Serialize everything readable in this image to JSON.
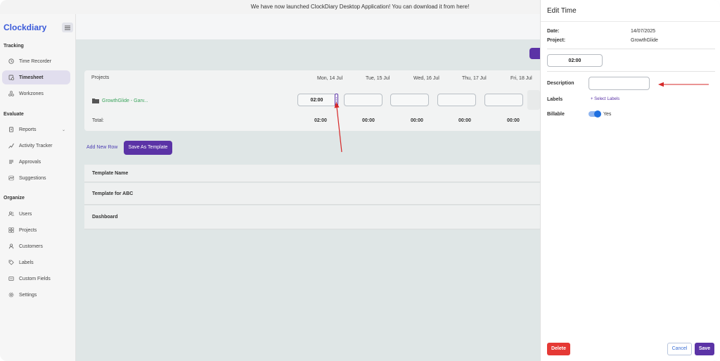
{
  "banner": {
    "text": "We have now launched ClockDiary Desktop Application! You can download it from here!"
  },
  "brand": {
    "logo": "Clockdiary",
    "color": "#3a5ad9",
    "accent": "#5b33a6"
  },
  "sidebar": {
    "sections": [
      {
        "title": "Tracking",
        "items": [
          {
            "label": "Time Recorder",
            "icon": "clock-icon"
          },
          {
            "label": "Timesheet",
            "icon": "timesheet-icon",
            "active": true
          },
          {
            "label": "Workzones",
            "icon": "workzones-icon"
          }
        ]
      },
      {
        "title": "Evaluate",
        "items": [
          {
            "label": "Reports",
            "icon": "reports-icon",
            "expandable": true
          },
          {
            "label": "Activity Tracker",
            "icon": "activity-icon"
          },
          {
            "label": "Approvals",
            "icon": "approvals-icon"
          },
          {
            "label": "Suggestions",
            "icon": "suggestions-icon"
          }
        ]
      },
      {
        "title": "Organize",
        "items": [
          {
            "label": "Users",
            "icon": "users-icon"
          },
          {
            "label": "Projects",
            "icon": "projects-icon"
          },
          {
            "label": "Customers",
            "icon": "customers-icon"
          },
          {
            "label": "Labels",
            "icon": "labels-icon"
          },
          {
            "label": "Custom Fields",
            "icon": "custom-fields-icon"
          },
          {
            "label": "Settings",
            "icon": "settings-icon"
          }
        ]
      }
    ]
  },
  "timesheet": {
    "projects_header": "Projects",
    "days": [
      "Mon, 14 Jul",
      "Tue, 15 Jul",
      "Wed, 16 Jul",
      "Thu, 17 Jul",
      "Fri, 18 Jul"
    ],
    "project_name": "GrowthGlide - Garv...",
    "entries": [
      "02:00",
      "",
      "",
      "",
      ""
    ],
    "total_label": "Total:",
    "totals": [
      "02:00",
      "00:00",
      "00:00",
      "00:00",
      "00:00"
    ]
  },
  "actions": {
    "add_new_row": "Add New Row",
    "save_as_template": "Save As Template"
  },
  "templates": {
    "rows": [
      "Template Name",
      "Template for ABC",
      "Dashboard"
    ]
  },
  "edit_panel": {
    "title": "Edit Time",
    "date_label": "Date:",
    "date_value": "14/07/2025",
    "project_label": "Project:",
    "project_value": "GrowthGlide",
    "duration": "02:00",
    "description_label": "Description",
    "description_value": "",
    "labels_label": "Labels",
    "select_labels": "+ Select Labels",
    "billable_label": "Billable",
    "billable_state": "Yes",
    "delete": "Delete",
    "cancel": "Cancel",
    "save": "Save"
  }
}
